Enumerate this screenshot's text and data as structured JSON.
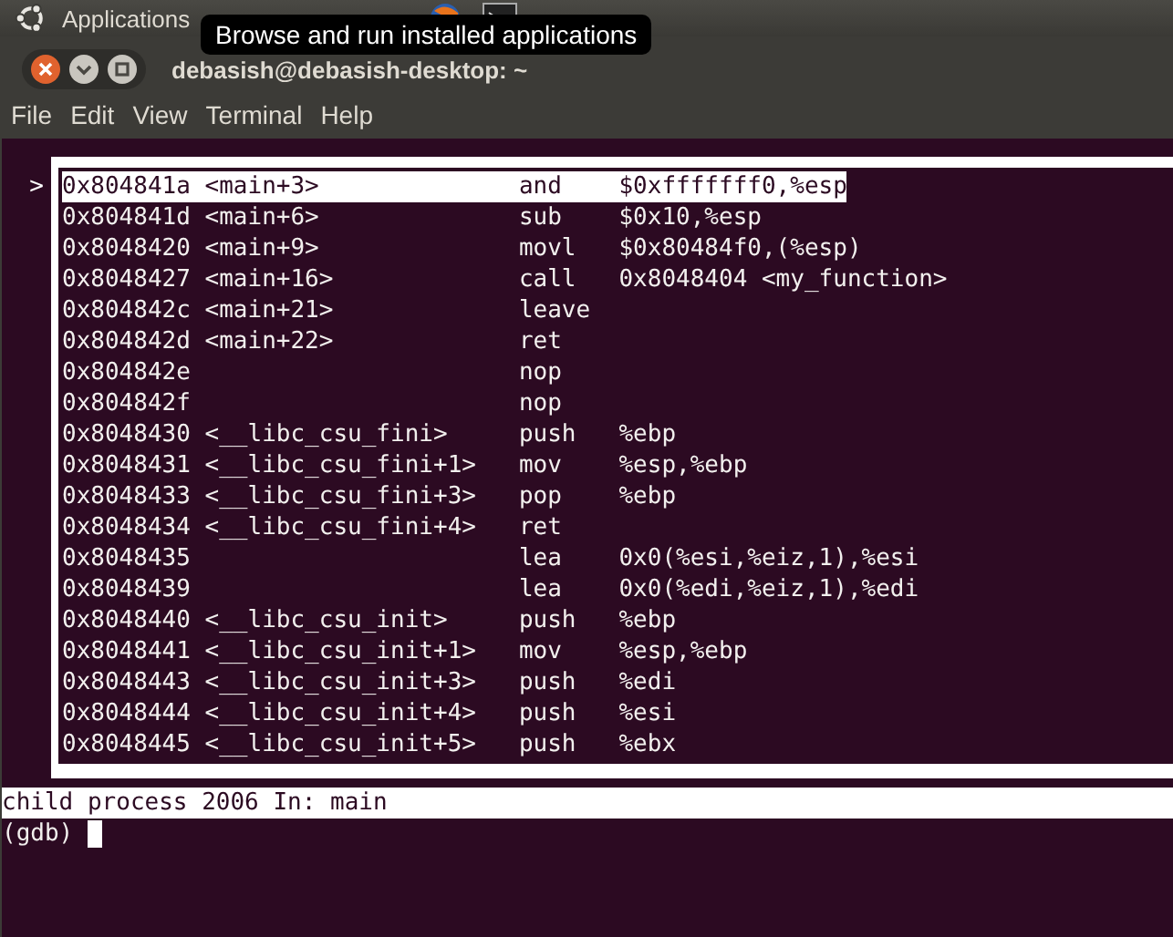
{
  "top_panel": {
    "menus": [
      "Applications"
    ]
  },
  "tooltip": {
    "text": "Browse and run installed applications"
  },
  "window": {
    "title": "debasish@debasish-desktop: ~"
  },
  "menu_bar": [
    "File",
    "Edit",
    "View",
    "Terminal",
    "Help"
  ],
  "disassembly": {
    "marker": ">",
    "rows": [
      {
        "address": "0x804841a",
        "symbol": "<main+3>",
        "mnemonic": "and",
        "operands": "$0xfffffff0,%esp",
        "selected": true
      },
      {
        "address": "0x804841d",
        "symbol": "<main+6>",
        "mnemonic": "sub",
        "operands": "$0x10,%esp",
        "selected": false
      },
      {
        "address": "0x8048420",
        "symbol": "<main+9>",
        "mnemonic": "movl",
        "operands": "$0x80484f0,(%esp)",
        "selected": false
      },
      {
        "address": "0x8048427",
        "symbol": "<main+16>",
        "mnemonic": "call",
        "operands": "0x8048404 <my_function>",
        "selected": false
      },
      {
        "address": "0x804842c",
        "symbol": "<main+21>",
        "mnemonic": "leave",
        "selected": false
      },
      {
        "address": "0x804842d",
        "symbol": "<main+22>",
        "mnemonic": "ret",
        "selected": false
      },
      {
        "address": "0x804842e",
        "mnemonic": "nop",
        "selected": false
      },
      {
        "address": "0x804842f",
        "mnemonic": "nop",
        "selected": false
      },
      {
        "address": "0x8048430",
        "symbol": "<__libc_csu_fini>",
        "mnemonic": "push",
        "operands": "%ebp",
        "selected": false
      },
      {
        "address": "0x8048431",
        "symbol": "<__libc_csu_fini+1>",
        "mnemonic": "mov",
        "operands": "%esp,%ebp",
        "selected": false
      },
      {
        "address": "0x8048433",
        "symbol": "<__libc_csu_fini+3>",
        "mnemonic": "pop",
        "operands": "%ebp",
        "selected": false
      },
      {
        "address": "0x8048434",
        "symbol": "<__libc_csu_fini+4>",
        "mnemonic": "ret",
        "selected": false
      },
      {
        "address": "0x8048435",
        "mnemonic": "lea",
        "operands": "0x0(%esi,%eiz,1),%esi",
        "selected": false
      },
      {
        "address": "0x8048439",
        "mnemonic": "lea",
        "operands": "0x0(%edi,%eiz,1),%edi",
        "selected": false
      },
      {
        "address": "0x8048440",
        "symbol": "<__libc_csu_init>",
        "mnemonic": "push",
        "operands": "%ebp",
        "selected": false
      },
      {
        "address": "0x8048441",
        "symbol": "<__libc_csu_init+1>",
        "mnemonic": "mov",
        "operands": "%esp,%ebp",
        "selected": false
      },
      {
        "address": "0x8048443",
        "symbol": "<__libc_csu_init+3>",
        "mnemonic": "push",
        "operands": "%edi",
        "selected": false
      },
      {
        "address": "0x8048444",
        "symbol": "<__libc_csu_init+4>",
        "mnemonic": "push",
        "operands": "%esi",
        "selected": false
      },
      {
        "address": "0x8048445",
        "symbol": "<__libc_csu_init+5>",
        "mnemonic": "push",
        "operands": "%ebx",
        "selected": false
      }
    ]
  },
  "status_line": "child process 2006 In: main",
  "prompt": "(gdb)"
}
